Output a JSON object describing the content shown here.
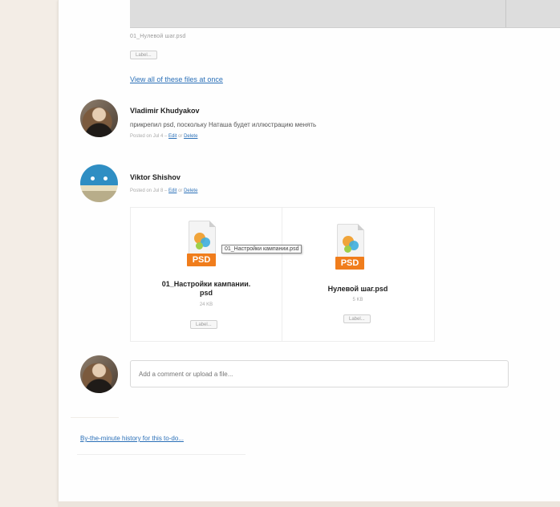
{
  "top_attachment": {
    "file_name": "01_Нулевой шаг.psd",
    "button_label": "Label..."
  },
  "view_all_link": "View all of these files at once",
  "comments": [
    {
      "author": "Vladimir Khudyakov",
      "text": "прикрепил psd, поскольку Наташа будет иллюстрацию менять",
      "posted": "Posted on Jul 4 –",
      "edit_label": "Edit",
      "or_label": "or",
      "delete_label": "Delete"
    },
    {
      "author": "Viktor Shishov",
      "posted": "Posted on Jul 8 –",
      "edit_label": "Edit",
      "or_label": "or",
      "delete_label": "Delete"
    }
  ],
  "files": [
    {
      "icon_label": "PSD",
      "name_line1": "01_Настройки кампании.",
      "name_line2": "psd",
      "size": "24 KB",
      "button_label": "Label..."
    },
    {
      "icon_label": "PSD",
      "name_line1": "Нулевой шаг.psd",
      "size": "5 KB",
      "button_label": "Label..."
    }
  ],
  "tooltip": "01_Настройки кампании.psd",
  "comment_input": {
    "placeholder": "Add a comment or upload a file..."
  },
  "history_link": "By-the-minute history for this to-do...",
  "colors": {
    "background": "#f3ede6",
    "link": "#2b70b8",
    "psd_orange": "#f07d1c"
  }
}
